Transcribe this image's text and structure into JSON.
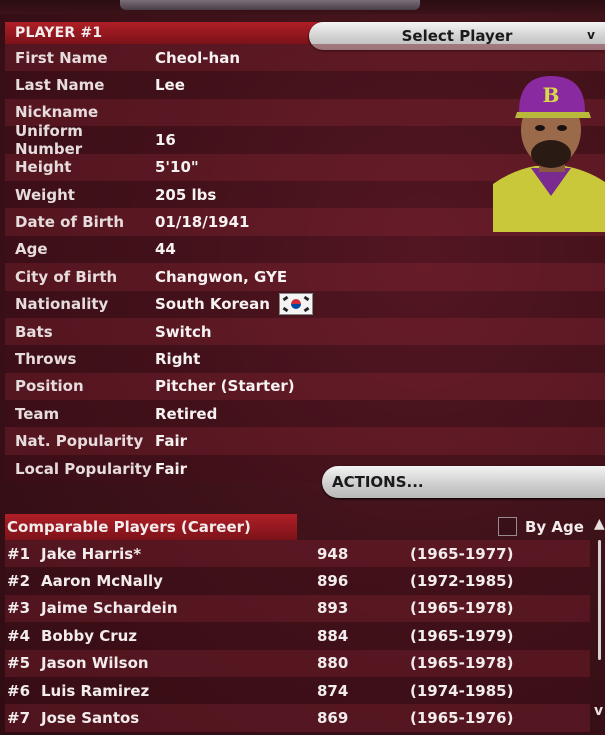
{
  "player": {
    "header": "PLAYER #1",
    "select_label": "Select Player",
    "select_chevron": "v",
    "fields": [
      {
        "label": "First Name",
        "value": "Cheol-han"
      },
      {
        "label": "Last Name",
        "value": "Lee"
      },
      {
        "label": "Nickname",
        "value": ""
      },
      {
        "label": "Uniform Number",
        "value": "16"
      },
      {
        "label": "Height",
        "value": "5'10\""
      },
      {
        "label": "Weight",
        "value": "205 lbs"
      },
      {
        "label": "Date of Birth",
        "value": "01/18/1941"
      },
      {
        "label": "Age",
        "value": "44"
      },
      {
        "label": "City of Birth",
        "value": "Changwon, GYE"
      },
      {
        "label": "Nationality",
        "value": "South Korean"
      },
      {
        "label": "Bats",
        "value": "Switch"
      },
      {
        "label": "Throws",
        "value": "Right"
      },
      {
        "label": "Position",
        "value": "Pitcher (Starter)"
      },
      {
        "label": "Team",
        "value": "Retired"
      },
      {
        "label": "Nat. Popularity",
        "value": "Fair"
      },
      {
        "label": "Local Popularity",
        "value": "Fair"
      }
    ],
    "actions_label": "ACTIONS..."
  },
  "comparable": {
    "header": "Comparable Players (Career)",
    "by_age_label": "By Age",
    "by_age_checked": false,
    "rows": [
      {
        "rank": "#1",
        "name": "Jake Harris*",
        "score": "948",
        "years": "(1965-1977)"
      },
      {
        "rank": "#2",
        "name": "Aaron McNally",
        "score": "896",
        "years": "(1972-1985)"
      },
      {
        "rank": "#3",
        "name": "Jaime Schardein",
        "score": "893",
        "years": "(1965-1978)"
      },
      {
        "rank": "#4",
        "name": "Bobby Cruz",
        "score": "884",
        "years": "(1965-1979)"
      },
      {
        "rank": "#5",
        "name": "Jason Wilson",
        "score": "880",
        "years": "(1965-1978)"
      },
      {
        "rank": "#6",
        "name": "Luis Ramirez",
        "score": "874",
        "years": "(1974-1985)"
      },
      {
        "rank": "#7",
        "name": "Jose Santos",
        "score": "869",
        "years": "(1965-1976)"
      }
    ]
  },
  "icons": {
    "flag": "south-korea-flag-icon",
    "portrait": "player-portrait",
    "scroll_up": "chevron-up-icon",
    "scroll_down": "chevron-down-icon"
  },
  "colors": {
    "header_red": "#b01f27",
    "background": "#40121a",
    "button_face": "#cfcfcf",
    "cap_purple": "#8a2aa0",
    "jersey_yellow": "#c8c83a"
  }
}
